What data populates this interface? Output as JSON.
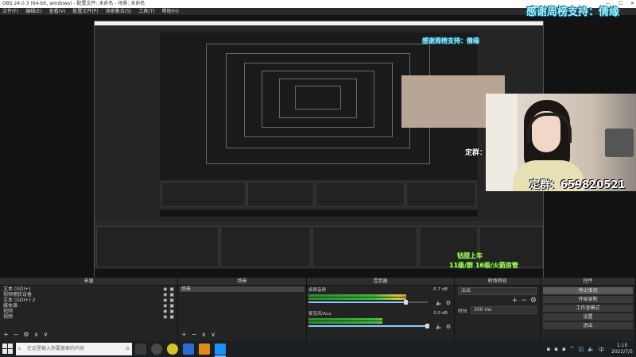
{
  "window": {
    "title": "OBS 24.0.3 (64-bit, windows) - 配置文件: 未命名 - 场景: 未命名",
    "controls": [
      "—",
      "☐",
      "✕"
    ]
  },
  "menu": {
    "items": [
      "文件(F)",
      "编辑(E)",
      "查看(V)",
      "配置文件(P)",
      "场景集合(S)",
      "工具(T)",
      "帮助(H)"
    ]
  },
  "overlays": {
    "thanks_text": "感谢周榜支持：倩缘",
    "group_text": "定群：659820521",
    "group_short": "定群：",
    "gift_line1": "钻甜上车",
    "gift_line2": "11级/群 16级/火箭房管"
  },
  "docks": {
    "scenes": {
      "title": "场景",
      "items": [
        "场景"
      ]
    },
    "sources": {
      "title": "来源",
      "items": [
        "文本 (GDI+)",
        "视频捕获设备",
        "文本 (GDI+) 2",
        "媒体源",
        "视频",
        "视频"
      ]
    },
    "mixer": {
      "title": "混音器",
      "channels": [
        {
          "name": "桌面音频",
          "db": "-5.7 dB",
          "level": 0.82,
          "volume": 0.82
        },
        {
          "name": "麦克风/Aux",
          "db": "0.0 dB",
          "level": 0.62,
          "volume": 1.0
        }
      ]
    },
    "transitions": {
      "title": "转场特效",
      "type": "淡出",
      "duration_label": "时长",
      "duration_value": "300 ms"
    },
    "controls": {
      "title": "控件",
      "buttons": [
        "停止推流",
        "开始录制",
        "工作室模式",
        "设置",
        "退出"
      ]
    }
  },
  "taskbar": {
    "search_placeholder": "在这里输入你要搜索的内容",
    "time": "1:10",
    "date": "2022/7/5",
    "apps": [
      {
        "name": "obs-app",
        "color": "#3a3a3a"
      },
      {
        "name": "record-app",
        "color": "#4a4a4a"
      },
      {
        "name": "yellow-circle-app",
        "color": "#d8c12a"
      },
      {
        "name": "store-app",
        "color": "#2e6bd6"
      },
      {
        "name": "orange-app",
        "color": "#e08a1e"
      },
      {
        "name": "check-app",
        "color": "#1e90ff"
      }
    ]
  },
  "colors": {
    "accent": "#8cf",
    "meter_green": "#3dbb3d",
    "meter_red": "#c93a3a",
    "thanks": "#9ff0ff",
    "gift": "#b6ff7a"
  }
}
